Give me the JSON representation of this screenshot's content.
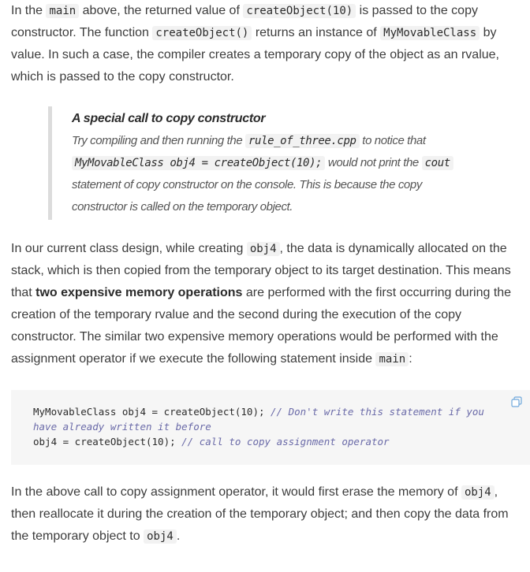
{
  "para1": {
    "t1": "In the ",
    "c1": "main",
    "t2": " above, the returned value of ",
    "c2": "createObject(10)",
    "t3": " is passed to the copy constructor. The function ",
    "c3": "createObject()",
    "t4": " returns an instance of ",
    "c4": "MyMovableClass",
    "t5": " by value. In such a case, the compiler creates a temporary copy of the object as an rvalue, which is passed to the copy constructor."
  },
  "note": {
    "title": "A special call to copy constructor",
    "t1": "Try compiling and then running the ",
    "c1": "rule_of_three.cpp",
    "t2": " to notice that ",
    "c2": "MyMovableClass obj4 = createObject(10);",
    "t3": " would not print the ",
    "c3": "cout",
    "t4": " statement of copy constructor on the console. This is because the copy constructor is called on the temporary object."
  },
  "para2": {
    "t1": "In our current class design, while creating ",
    "c1": "obj4",
    "t2": ", the data is dynamically allocated on the stack, which is then copied from the temporary object to its target destination. This means that ",
    "b1": "two expensive memory operations",
    "t3": " are performed with the first occurring during the creation of the temporary rvalue and the second during the execution of the copy constructor. The similar two expensive memory operations would be performed with the assignment operator if we execute the following statement inside ",
    "c2": "main",
    "t4": ":"
  },
  "codeblock": {
    "line1_code": "MyMovableClass obj4 = createObject(10); ",
    "line1_comment": "// Don't write this statement if you have already written it before",
    "line2_code": "obj4 = createObject(10); ",
    "line2_comment": "// call to copy assignment operator",
    "copy_icon": "copy-icon"
  },
  "para3": {
    "t1": "In the above call to copy assignment operator, it would first erase the memory of ",
    "c1": "obj4",
    "t2": ", then reallocate it during the creation of the temporary object; and then copy the data from the temporary object to ",
    "c2": "obj4",
    "t3": "."
  },
  "colors": {
    "text": "#3c3c3c",
    "code_bg": "#f2f2f2",
    "block_bg": "#f6f6f6",
    "comment": "#6a6aa8",
    "copy_icon": "#6fa8dc"
  }
}
